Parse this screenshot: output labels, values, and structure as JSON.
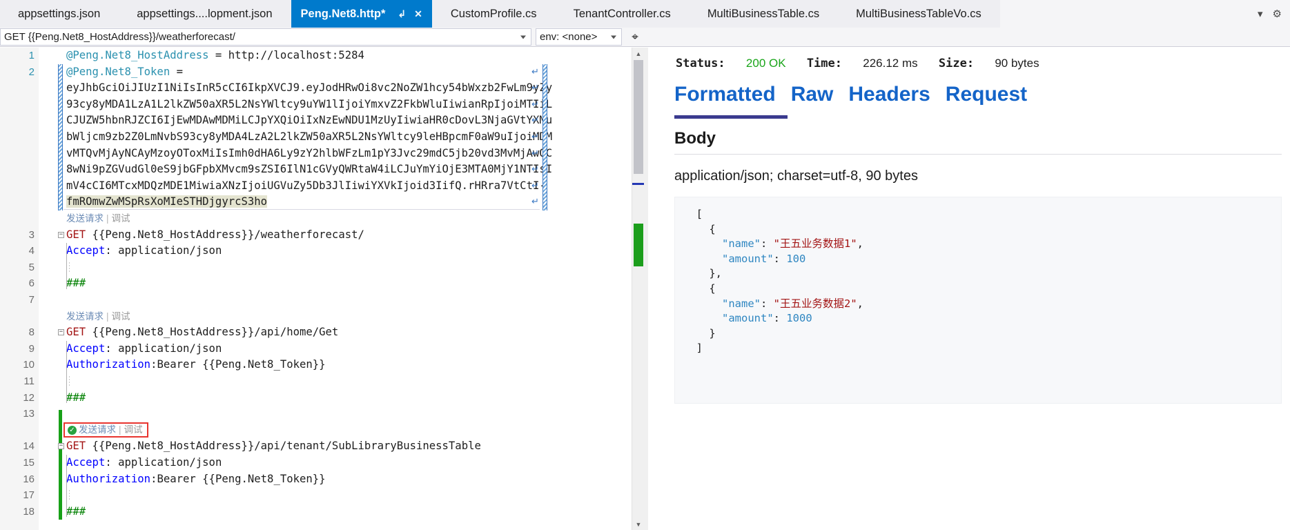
{
  "tabs": [
    {
      "label": "appsettings.json",
      "active": false
    },
    {
      "label": "appsettings....lopment.json",
      "active": false
    },
    {
      "label": "Peng.Net8.http*",
      "active": true,
      "pin_icon": "pin-icon",
      "close_icon": "close-icon"
    },
    {
      "label": "CustomProfile.cs",
      "active": false
    },
    {
      "label": "TenantController.cs",
      "active": false
    },
    {
      "label": "MultiBusinessTable.cs",
      "active": false
    },
    {
      "label": "MultiBusinessTableVo.cs",
      "active": false
    }
  ],
  "tabbar_right": {
    "overflow_icon": "chevron-down-icon",
    "settings_icon": "gear-icon"
  },
  "request_toolbar": {
    "request_value": "GET {{Peng.Net8_HostAddress}}/weatherforecast/",
    "request_placeholder": "GET {{Peng.Net8_HostAddress}}/weatherforecast/",
    "env_value": "env: <none>",
    "dropdown_icon": "chevron-down-icon",
    "split_icon": "split-view-icon"
  },
  "editor": {
    "lines": [
      {
        "num": "1",
        "kind": "var",
        "text": "@Peng.Net8_HostAddress = http://localhost:5284"
      },
      {
        "num": "2",
        "kind": "var",
        "text": "@Peng.Net8_Token ="
      },
      {
        "num": "",
        "kind": "token",
        "text": "eyJhbGciOiJIUzI1NiIsInR5cCI6IkpXVCJ9.eyJodHRwOi8vc2NoZW1hcy54bWxzb2FwLm9yZy"
      },
      {
        "num": "",
        "kind": "token",
        "text": "93cy8yMDA1LzA1L2lkZW50aXR5L2NsYWltcy9uYW1lIjoiYmxvZ2FkbWluIiwianRpIjoiMTIiL"
      },
      {
        "num": "",
        "kind": "token",
        "text": "CJUZW5hbnRJZCI6IjEwMDAwMDMiLCJpYXQiOiIxNzEwNDU1MzUyIiwiaHR0cDovL3NjaGVtYXMu"
      },
      {
        "num": "",
        "kind": "token",
        "text": "bWljcm9zb2Z0LmNvbS93cy8yMDA4LzA2L2lkZW50aXR5L2NsYWltcy9leHBpcmF0aW9uIjoiMDM"
      },
      {
        "num": "",
        "kind": "token",
        "text": "vMTQvMjAyNCAyMzoyOToxMiIsImh0dHA6Ly9zY2hlbWFzLm1pY3Jvc29mdC5jb20vd3MvMjAwOC"
      },
      {
        "num": "",
        "kind": "token",
        "text": "8wNi9pZGVudGl0eS9jbGFpbXMvcm9sZSI6IlN1cGVyQWRtaW4iLCJuYmYiOjE3MTA0MjY1NTIsI"
      },
      {
        "num": "",
        "kind": "token",
        "text": "mV4cCI6MTcxMDQzMDE1MiwiaXNzIjoiUGVuZy5Db3JlIiwiYXVkIjoid3IifQ.rHRra7VtCtI-"
      },
      {
        "num": "",
        "kind": "tokenhl",
        "text": "fmROmwZwMSpRsXoMIeSTHDjgyrcS3ho"
      },
      {
        "num": "",
        "kind": "codelens",
        "send": "发送请求",
        "sep": "|",
        "debug": "调试",
        "boxed": false
      },
      {
        "num": "3",
        "kind": "get",
        "text": "GET {{Peng.Net8_HostAddress}}/weatherforecast/"
      },
      {
        "num": "4",
        "kind": "header",
        "text": "Accept: application/json"
      },
      {
        "num": "5",
        "kind": "blank",
        "text": ""
      },
      {
        "num": "6",
        "kind": "hash",
        "text": "###"
      },
      {
        "num": "7",
        "kind": "empty",
        "text": ""
      },
      {
        "num": "",
        "kind": "codelens",
        "send": "发送请求",
        "sep": "|",
        "debug": "调试",
        "boxed": false
      },
      {
        "num": "8",
        "kind": "get",
        "text": "GET {{Peng.Net8_HostAddress}}/api/home/Get"
      },
      {
        "num": "9",
        "kind": "header",
        "text": "Accept: application/json"
      },
      {
        "num": "10",
        "kind": "header",
        "text": "Authorization:Bearer {{Peng.Net8_Token}}"
      },
      {
        "num": "11",
        "kind": "blank",
        "text": ""
      },
      {
        "num": "12",
        "kind": "hash",
        "text": "###"
      },
      {
        "num": "13",
        "kind": "empty",
        "text": ""
      },
      {
        "num": "",
        "kind": "codelens",
        "send": "发送请求",
        "sep": "|",
        "debug": "调试",
        "boxed": true,
        "status_icon": "success-check-icon"
      },
      {
        "num": "14",
        "kind": "get",
        "text": "GET {{Peng.Net8_HostAddress}}/api/tenant/SubLibraryBusinessTable"
      },
      {
        "num": "15",
        "kind": "header",
        "text": "Accept: application/json"
      },
      {
        "num": "16",
        "kind": "header",
        "text": "Authorization:Bearer {{Peng.Net8_Token}}"
      },
      {
        "num": "17",
        "kind": "blank",
        "text": ""
      },
      {
        "num": "18",
        "kind": "hash",
        "text": "###"
      }
    ],
    "scrollbar": {
      "up_icon": "scroll-up-arrow",
      "down_icon": "scroll-down-arrow"
    }
  },
  "response": {
    "status_label": "Status:",
    "status_value": "200 OK",
    "time_label": "Time:",
    "time_value": "226.12 ms",
    "size_label": "Size:",
    "size_value": "90 bytes",
    "tabs": [
      {
        "label": "Formatted",
        "active": true
      },
      {
        "label": "Raw",
        "active": false
      },
      {
        "label": "Headers",
        "active": false
      },
      {
        "label": "Request",
        "active": false
      }
    ],
    "body_title": "Body",
    "body_meta": "application/json; charset=utf-8, 90 bytes",
    "body_json_lines": [
      {
        "indent": 0,
        "parts": [
          {
            "t": "punct",
            "v": "["
          }
        ]
      },
      {
        "indent": 1,
        "parts": [
          {
            "t": "punct",
            "v": "{"
          }
        ]
      },
      {
        "indent": 2,
        "parts": [
          {
            "t": "key",
            "v": "\"name\""
          },
          {
            "t": "punct",
            "v": ": "
          },
          {
            "t": "str",
            "v": "\"王五业务数据1\""
          },
          {
            "t": "punct",
            "v": ","
          }
        ]
      },
      {
        "indent": 2,
        "parts": [
          {
            "t": "key",
            "v": "\"amount\""
          },
          {
            "t": "punct",
            "v": ": "
          },
          {
            "t": "num",
            "v": "100"
          }
        ]
      },
      {
        "indent": 1,
        "parts": [
          {
            "t": "punct",
            "v": "},"
          }
        ]
      },
      {
        "indent": 1,
        "parts": [
          {
            "t": "punct",
            "v": "{"
          }
        ]
      },
      {
        "indent": 2,
        "parts": [
          {
            "t": "key",
            "v": "\"name\""
          },
          {
            "t": "punct",
            "v": ": "
          },
          {
            "t": "str",
            "v": "\"王五业务数据2\""
          },
          {
            "t": "punct",
            "v": ","
          }
        ]
      },
      {
        "indent": 2,
        "parts": [
          {
            "t": "key",
            "v": "\"amount\""
          },
          {
            "t": "punct",
            "v": ": "
          },
          {
            "t": "num",
            "v": "1000"
          }
        ]
      },
      {
        "indent": 1,
        "parts": [
          {
            "t": "punct",
            "v": "}"
          }
        ]
      },
      {
        "indent": 0,
        "parts": [
          {
            "t": "punct",
            "v": "]"
          }
        ]
      }
    ]
  },
  "colors": {
    "active_tab_bg": "#007acc",
    "tabbar_bg": "#eeeef2",
    "response_tab_blue": "#1464c8",
    "underline_purple": "#3b3b8f",
    "status_ok_green": "#1aa51a",
    "highlight_red_box": "#e8352f",
    "change_bar_green": "#18a018"
  }
}
